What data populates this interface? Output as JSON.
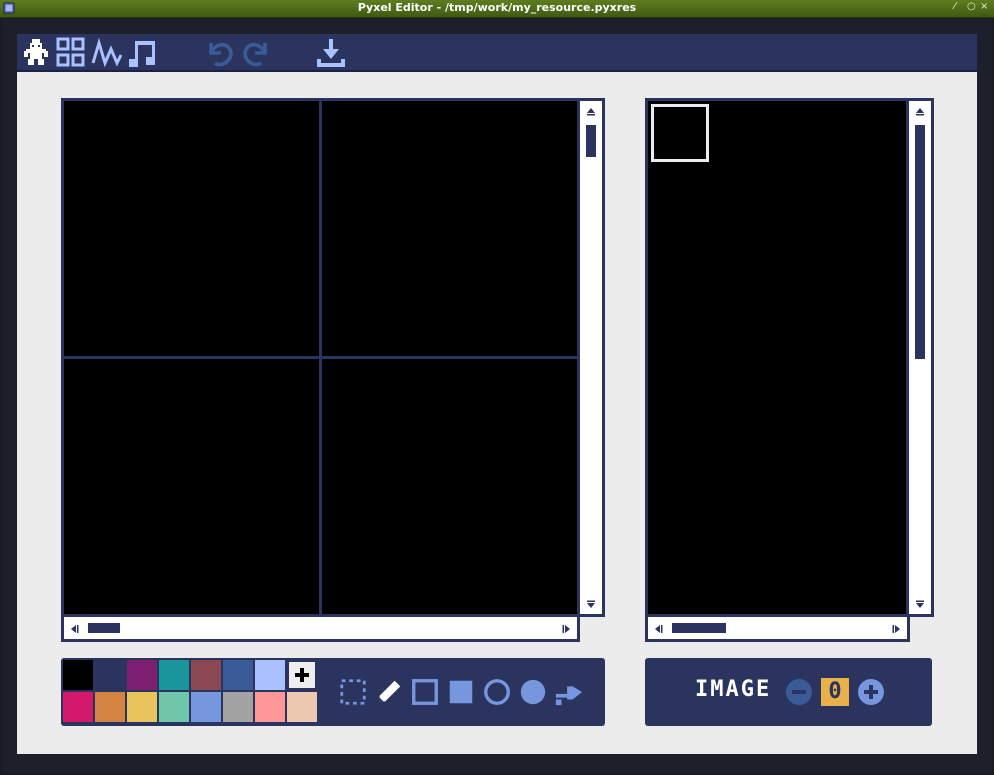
{
  "window": {
    "title": "Pyxel Editor - /tmp/work/my_resource.pyxres",
    "controls": [
      "⁄",
      "○",
      "×"
    ]
  },
  "toolbar": {
    "items": [
      {
        "name": "image-editor-icon"
      },
      {
        "name": "tilemap-editor-icon"
      },
      {
        "name": "sound-editor-icon"
      },
      {
        "name": "music-editor-icon"
      },
      {
        "name": "undo-icon"
      },
      {
        "name": "redo-icon"
      },
      {
        "name": "save-icon"
      }
    ]
  },
  "palette": {
    "colors": [
      "#000000",
      "#2b335f",
      "#7e2072",
      "#19959c",
      "#8b4852",
      "#395c98",
      "#a9c1ff",
      "#eeeeee",
      "#d4186c",
      "#d38441",
      "#e9c35b",
      "#70c6a9",
      "#7696de",
      "#a3a3a3",
      "#ff9798",
      "#edc7b0"
    ],
    "selected_index": 7
  },
  "tools": [
    "select-tool-icon",
    "pencil-tool-icon",
    "rect-outline-tool-icon",
    "rect-fill-tool-icon",
    "circle-outline-tool-icon",
    "circle-fill-tool-icon",
    "bucket-fill-tool-icon"
  ],
  "image_selector": {
    "label": "IMAGE",
    "value": "0"
  }
}
